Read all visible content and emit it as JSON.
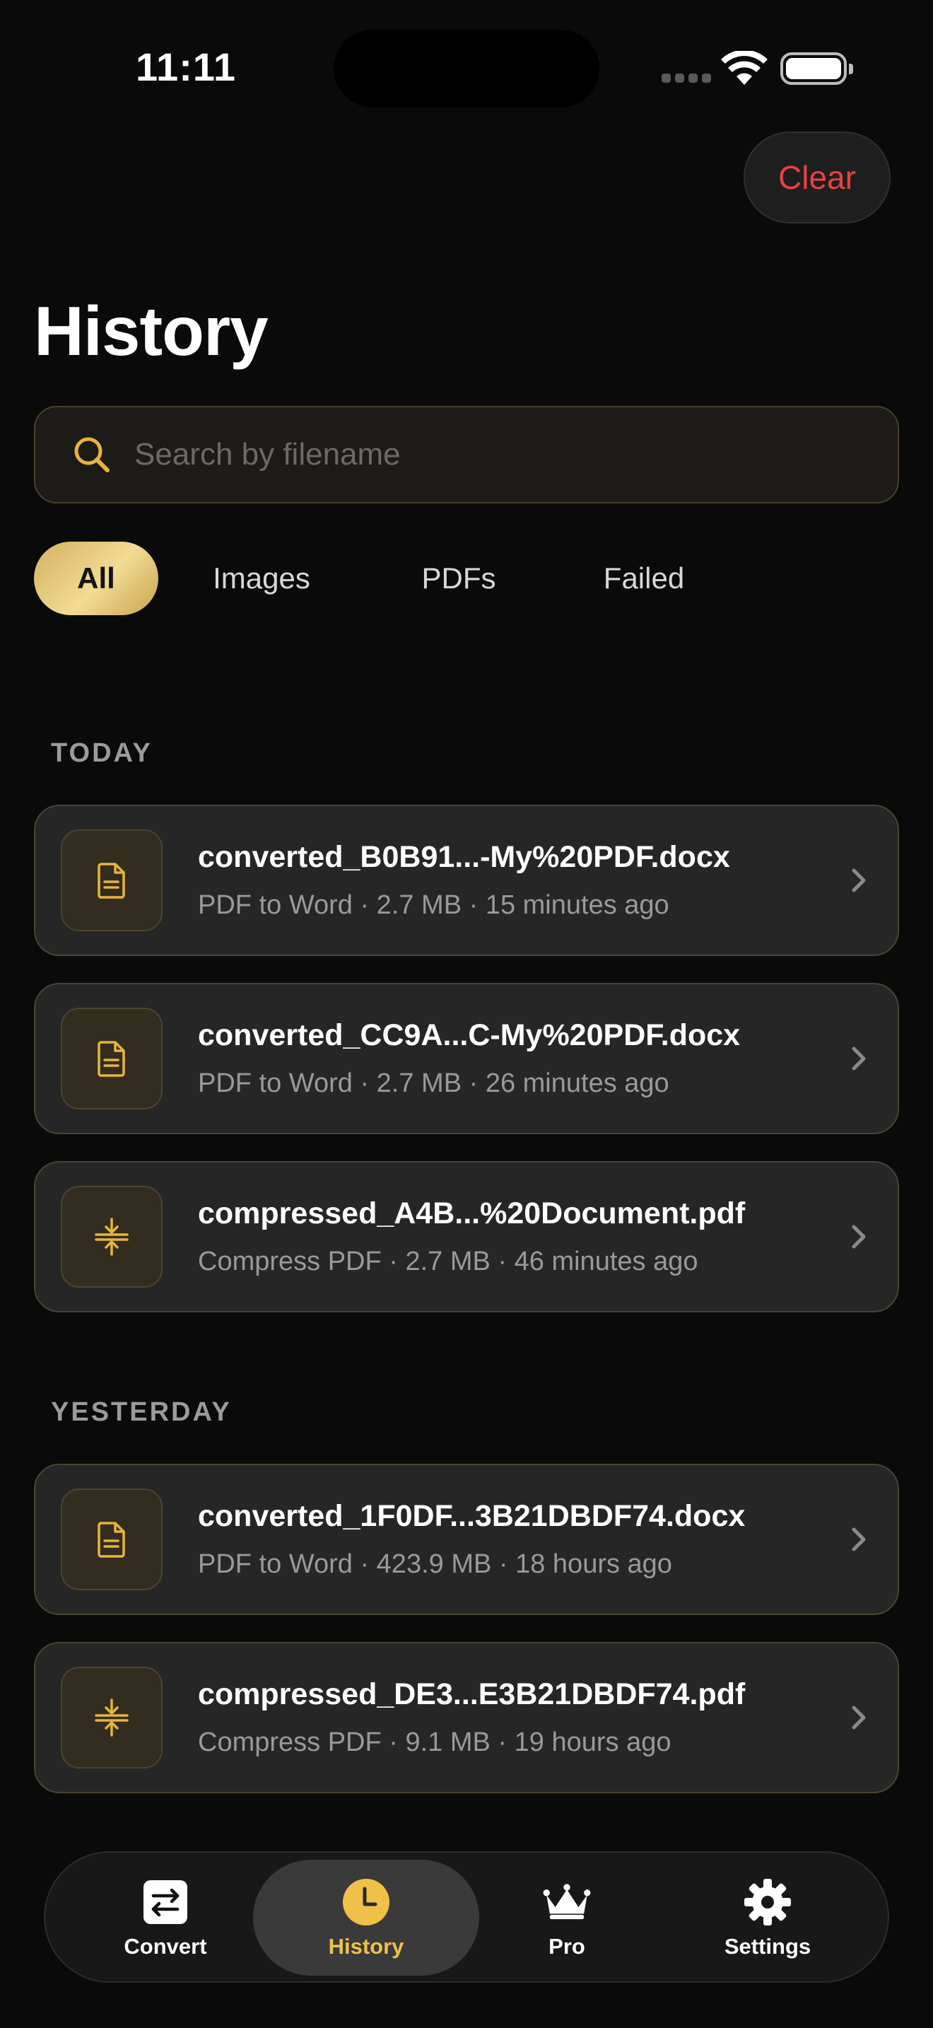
{
  "status_bar": {
    "time": "11:11"
  },
  "header": {
    "clear_label": "Clear",
    "title": "History"
  },
  "search": {
    "placeholder": "Search by filename",
    "value": ""
  },
  "filters": {
    "items": [
      "All",
      "Images",
      "PDFs",
      "Failed"
    ],
    "active": "All"
  },
  "sections": [
    {
      "label": "TODAY",
      "items": [
        {
          "filename": "converted_B0B91...-My%20PDF.docx",
          "meta": "PDF to Word · 2.7 MB · 15 minutes ago",
          "icon": "document-icon"
        },
        {
          "filename": "converted_CC9A...C-My%20PDF.docx",
          "meta": "PDF to Word · 2.7 MB · 26 minutes ago",
          "icon": "document-icon"
        },
        {
          "filename": "compressed_A4B...%20Document.pdf",
          "meta": "Compress PDF · 2.7 MB · 46 minutes ago",
          "icon": "compress-icon"
        }
      ]
    },
    {
      "label": "YESTERDAY",
      "items": [
        {
          "filename": "converted_1F0DF...3B21DBDF74.docx",
          "meta": "PDF to Word · 423.9 MB · 18 hours ago",
          "icon": "document-icon"
        },
        {
          "filename": "compressed_DE3...E3B21DBDF74.pdf",
          "meta": "Compress PDF · 9.1 MB · 19 hours ago",
          "icon": "compress-icon"
        }
      ]
    }
  ],
  "tabbar": {
    "items": [
      {
        "label": "Convert",
        "icon": "convert-icon"
      },
      {
        "label": "History",
        "icon": "clock-icon"
      },
      {
        "label": "Pro",
        "icon": "crown-icon"
      },
      {
        "label": "Settings",
        "icon": "gear-icon"
      }
    ],
    "active": "History"
  },
  "colors": {
    "accent": "#f0c14a",
    "destructive": "#e94242",
    "background": "#0a0a0a",
    "card": "#262626"
  }
}
